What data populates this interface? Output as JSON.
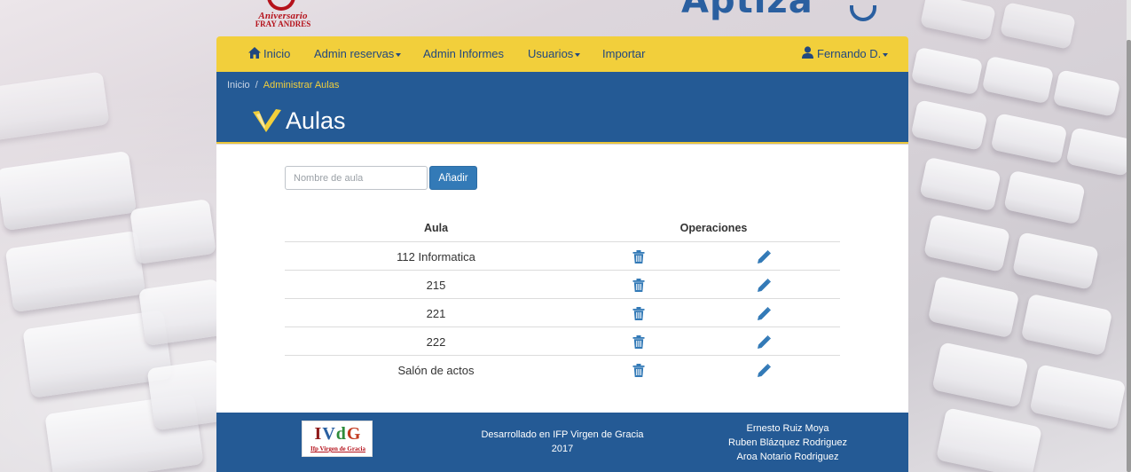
{
  "logos": {
    "top_left_line1": "Aniversario",
    "top_left_line2": "FRAY ANDRES",
    "top_right": "Aptiza"
  },
  "nav": {
    "home": "Inicio",
    "admin_reservas": "Admin reservas",
    "admin_informes": "Admin Informes",
    "usuarios": "Usuarios",
    "importar": "Importar",
    "user": "Fernando D."
  },
  "breadcrumb": {
    "home": "Inicio",
    "separator": "/",
    "current": "Administrar Aulas"
  },
  "page": {
    "title": "Aulas"
  },
  "form": {
    "placeholder": "Nombre de aula",
    "value": "",
    "add_button": "Añadir"
  },
  "table": {
    "headers": {
      "aula": "Aula",
      "operaciones": "Operaciones"
    },
    "rows": [
      {
        "name": "112 Informatica",
        "delete_icon": "trash-icon",
        "edit_icon": "pencil-icon"
      },
      {
        "name": "215",
        "delete_icon": "trash-icon",
        "edit_icon": "pencil-icon"
      },
      {
        "name": "221",
        "delete_icon": "trash-icon",
        "edit_icon": "pencil-icon"
      },
      {
        "name": "222",
        "delete_icon": "trash-icon",
        "edit_icon": "pencil-icon"
      },
      {
        "name": "Salón de actos",
        "delete_icon": "trash-icon",
        "edit_icon": "pencil-icon"
      }
    ]
  },
  "footer": {
    "logo_text": "IVdG",
    "logo_subtitle": "Ifp Virgen de Gracia",
    "developed_line1": "Desarrollado en IFP Virgen de Gracia",
    "developed_line2": "2017",
    "authors": [
      "Ernesto Ruiz Moya",
      "Ruben Blázquez Rodriguez",
      "Aroa Notario Rodriguez"
    ]
  },
  "colors": {
    "navbar": "#f2cf3b",
    "header": "#245a95",
    "primary_button": "#337ab7",
    "icon_blue": "#337ab7",
    "brand_red": "#b5121b"
  }
}
